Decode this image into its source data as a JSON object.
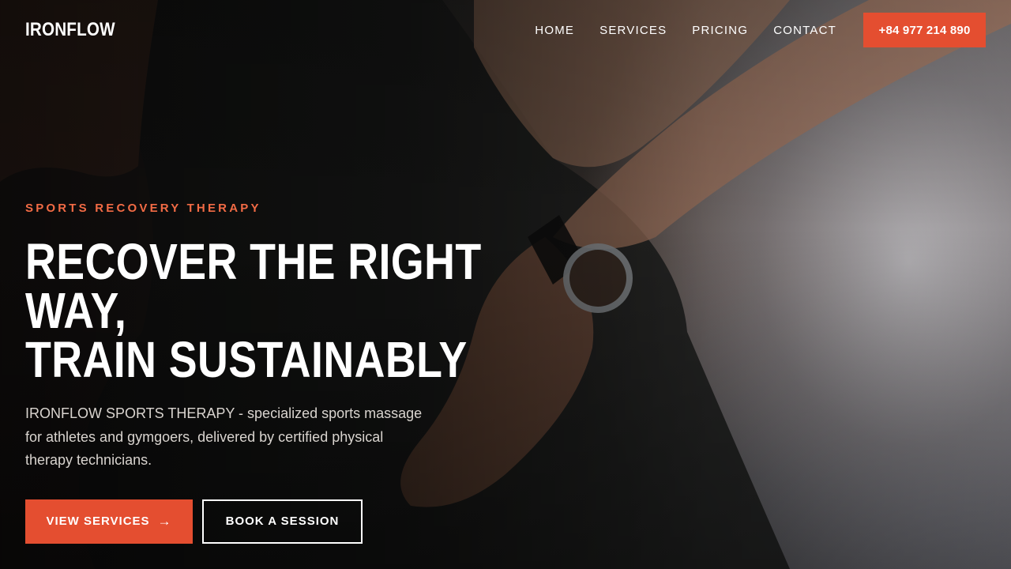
{
  "brand": {
    "name": "IRONFLOW"
  },
  "nav": {
    "links": [
      {
        "label": "HOME"
      },
      {
        "label": "SERVICES"
      },
      {
        "label": "PRICING"
      },
      {
        "label": "CONTACT"
      }
    ],
    "phone": "+84 977 214 890"
  },
  "hero": {
    "eyebrow": "SPORTS RECOVERY THERAPY",
    "headline_line1": "RECOVER THE RIGHT WAY,",
    "headline_line2": "TRAIN SUSTAINABLY",
    "description": "IRONFLOW SPORTS THERAPY - specialized sports massage for athletes and gymgoers, delivered by certified physical therapy technicians.",
    "primary_cta": "VIEW SERVICES",
    "primary_cta_icon": "arrow-right-icon",
    "secondary_cta": "BOOK A SESSION"
  },
  "colors": {
    "accent": "#e44e30",
    "eyebrow": "#f26b45"
  }
}
